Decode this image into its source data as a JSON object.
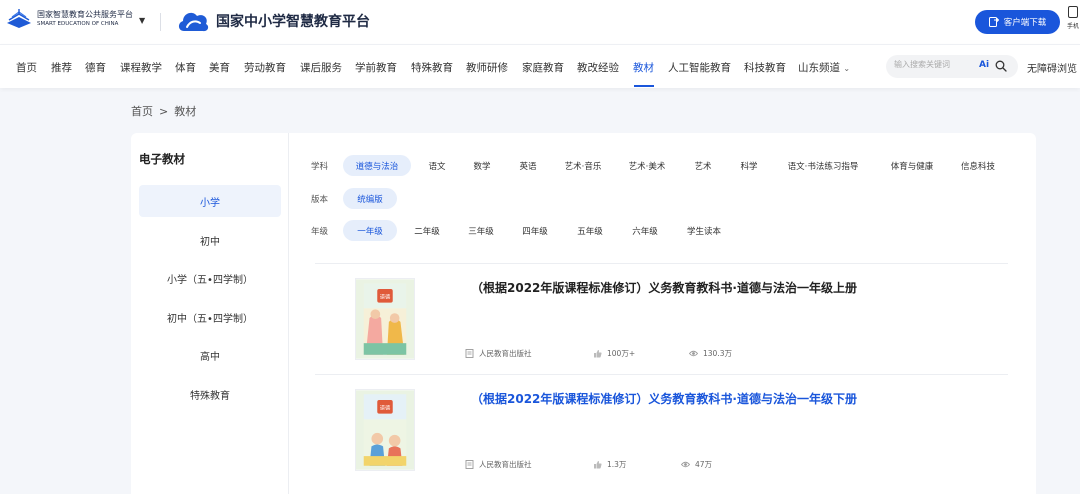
{
  "header": {
    "gov_logo_cn": "国家智慧教育公共服务平台",
    "gov_logo_en": "SMART EDUCATION OF CHINA",
    "platform_title": "国家中小学智慧教育平台",
    "download_label": "客户端下载",
    "phone_label": "手机"
  },
  "nav": {
    "items": [
      "首页",
      "推荐",
      "德育",
      "课程教学",
      "体育",
      "美育",
      "劳动教育",
      "课后服务",
      "学前教育",
      "特殊教育",
      "教师研修",
      "家庭教育",
      "教改经验",
      "教材",
      "人工智能教育",
      "科技教育",
      "山东频道"
    ],
    "active": "教材",
    "search_placeholder": "输入搜索关键词",
    "ai_label": "Ai",
    "accessible_label": "无障碍浏览"
  },
  "breadcrumb": {
    "home": "首页",
    "sep": ">",
    "current": "教材"
  },
  "sidebar": {
    "title": "电子教材",
    "items": [
      "小学",
      "初中",
      "小学（五•四学制）",
      "初中（五•四学制）",
      "高中",
      "特殊教育"
    ],
    "active": "小学"
  },
  "filters": {
    "subject_label": "学科",
    "subjects": [
      "道德与法治",
      "语文",
      "数学",
      "英语",
      "艺术·音乐",
      "艺术·美术",
      "艺术",
      "科学",
      "语文·书法练习指导",
      "体育与健康",
      "信息科技"
    ],
    "version_label": "版本",
    "versions": [
      "统编版"
    ],
    "grade_label": "年级",
    "grades": [
      "一年级",
      "二年级",
      "三年级",
      "四年级",
      "五年级",
      "六年级",
      "学生读本"
    ]
  },
  "books": [
    {
      "title": "（根据2022年版课程标准修订）义务教育教科书·道德与法治一年级上册",
      "publisher": "人民教育出版社",
      "likes": "100万+",
      "views": "130.3万",
      "cover_text": "道德与法治"
    },
    {
      "title": "（根据2022年版课程标准修订）义务教育教科书·道德与法治一年级下册",
      "publisher": "人民教育出版社",
      "likes": "1.3万",
      "views": "47万",
      "cover_text": "道德与法治"
    }
  ],
  "colors": {
    "accent": "#1a56db",
    "active_bg": "#e6eefb"
  }
}
